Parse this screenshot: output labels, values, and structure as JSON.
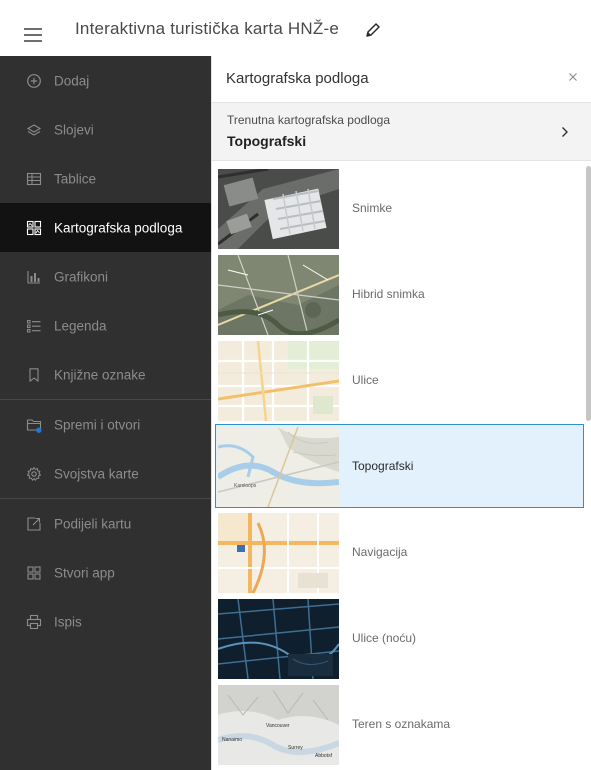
{
  "header": {
    "title": "Interaktivna turistička karta HNŽ-e",
    "menu_icon": "hamburger-icon",
    "edit_icon": "pencil-icon"
  },
  "sidebar": {
    "items": [
      {
        "label": "Dodaj",
        "icon": "plus-circle-icon",
        "active": false
      },
      {
        "label": "Slojevi",
        "icon": "layers-icon",
        "active": false
      },
      {
        "label": "Tablice",
        "icon": "table-icon",
        "active": false
      },
      {
        "label": "Kartografska podloga",
        "icon": "basemap-icon",
        "active": true
      },
      {
        "label": "Grafikoni",
        "icon": "bar-chart-icon",
        "active": false
      },
      {
        "label": "Legenda",
        "icon": "legend-icon",
        "active": false
      },
      {
        "label": "Knjižne oznake",
        "icon": "bookmark-icon",
        "active": false
      },
      {
        "label": "Spremi i otvori",
        "icon": "save-folder-icon",
        "active": false
      },
      {
        "label": "Svojstva karte",
        "icon": "gear-icon",
        "active": false
      },
      {
        "label": "Podijeli kartu",
        "icon": "share-icon",
        "active": false
      },
      {
        "label": "Stvori app",
        "icon": "apps-grid-icon",
        "active": false
      },
      {
        "label": "Ispis",
        "icon": "print-icon",
        "active": false
      }
    ]
  },
  "panel": {
    "title": "Kartografska podloga",
    "close_icon": "close-icon",
    "current_caption": "Trenutna kartografska podloga",
    "current_value": "Topografski",
    "basemaps": [
      {
        "label": "Snimke",
        "selected": false
      },
      {
        "label": "Hibrid snimka",
        "selected": false
      },
      {
        "label": "Ulice",
        "selected": false
      },
      {
        "label": "Topografski",
        "selected": true
      },
      {
        "label": "Navigacija",
        "selected": false
      },
      {
        "label": "Ulice (noću)",
        "selected": false
      },
      {
        "label": "Teren s oznakama",
        "selected": false
      }
    ]
  },
  "thumb_text": {
    "topo_place": "Kamloops",
    "terrain_a": "Vancouver",
    "terrain_b": "Nanaimo",
    "terrain_c": "Surrey",
    "terrain_d": "Abbotsf"
  },
  "colors": {
    "sidebar_bg": "#303030",
    "sidebar_active_bg": "#121212",
    "accent": "#2f8fce",
    "selected_bg": "#e2f1fb",
    "save_badge": "#1e7ad6"
  }
}
